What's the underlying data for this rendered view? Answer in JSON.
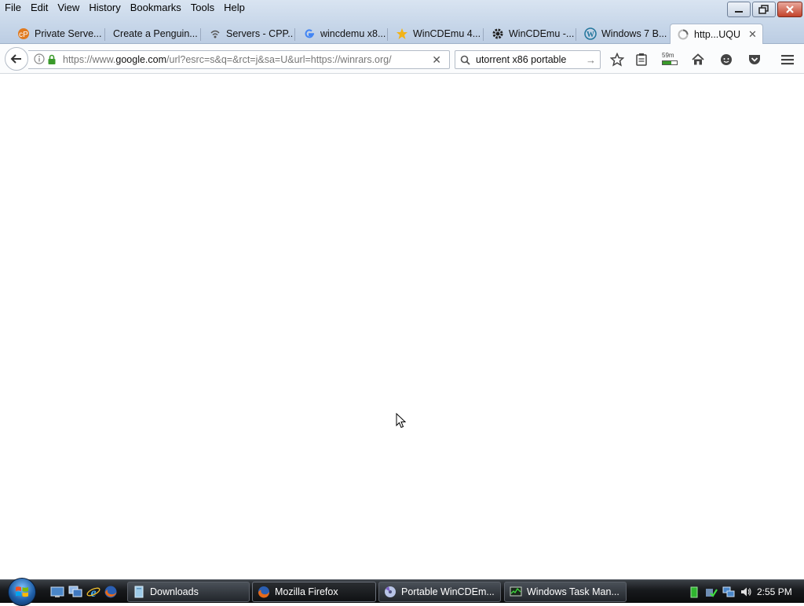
{
  "menubar": {
    "items": [
      "File",
      "Edit",
      "View",
      "History",
      "Bookmarks",
      "Tools",
      "Help"
    ]
  },
  "tabs": [
    {
      "label": "Private Serve...",
      "icon": "cpanel-icon"
    },
    {
      "label": "Create a Penguin...",
      "icon": "none"
    },
    {
      "label": "Servers - CPP...",
      "icon": "wifi-icon"
    },
    {
      "label": "wincdemu x8...",
      "icon": "google-icon"
    },
    {
      "label": "WinCDEmu 4...",
      "icon": "star-icon"
    },
    {
      "label": "WinCDEmu -...",
      "icon": "gear-icon"
    },
    {
      "label": "Windows 7 B...",
      "icon": "wordpress-icon"
    },
    {
      "label": "http...UQU",
      "icon": "loading-icon",
      "active": true
    }
  ],
  "navbar": {
    "url_prefix": "https://www.",
    "url_domain": "google.com",
    "url_rest": "/url?esrc=s&q=&rct=j&sa=U&url=https://winrars.org/",
    "search_value": "utorrent x86 portable",
    "downloads_badge": "59m"
  },
  "taskbar": {
    "buttons": [
      {
        "label": "Downloads",
        "icon": "folder-icon"
      },
      {
        "label": "Mozilla Firefox",
        "icon": "firefox-icon",
        "active": true
      },
      {
        "label": "Portable WinCDEm...",
        "icon": "wincdemu-icon"
      },
      {
        "label": "Windows Task Man...",
        "icon": "task-manager-icon"
      }
    ],
    "clock": "2:55 PM"
  },
  "colors": {
    "accent": "#1f5fa8",
    "lock_green": "#3a9a2a",
    "close_red": "#c2432b"
  }
}
